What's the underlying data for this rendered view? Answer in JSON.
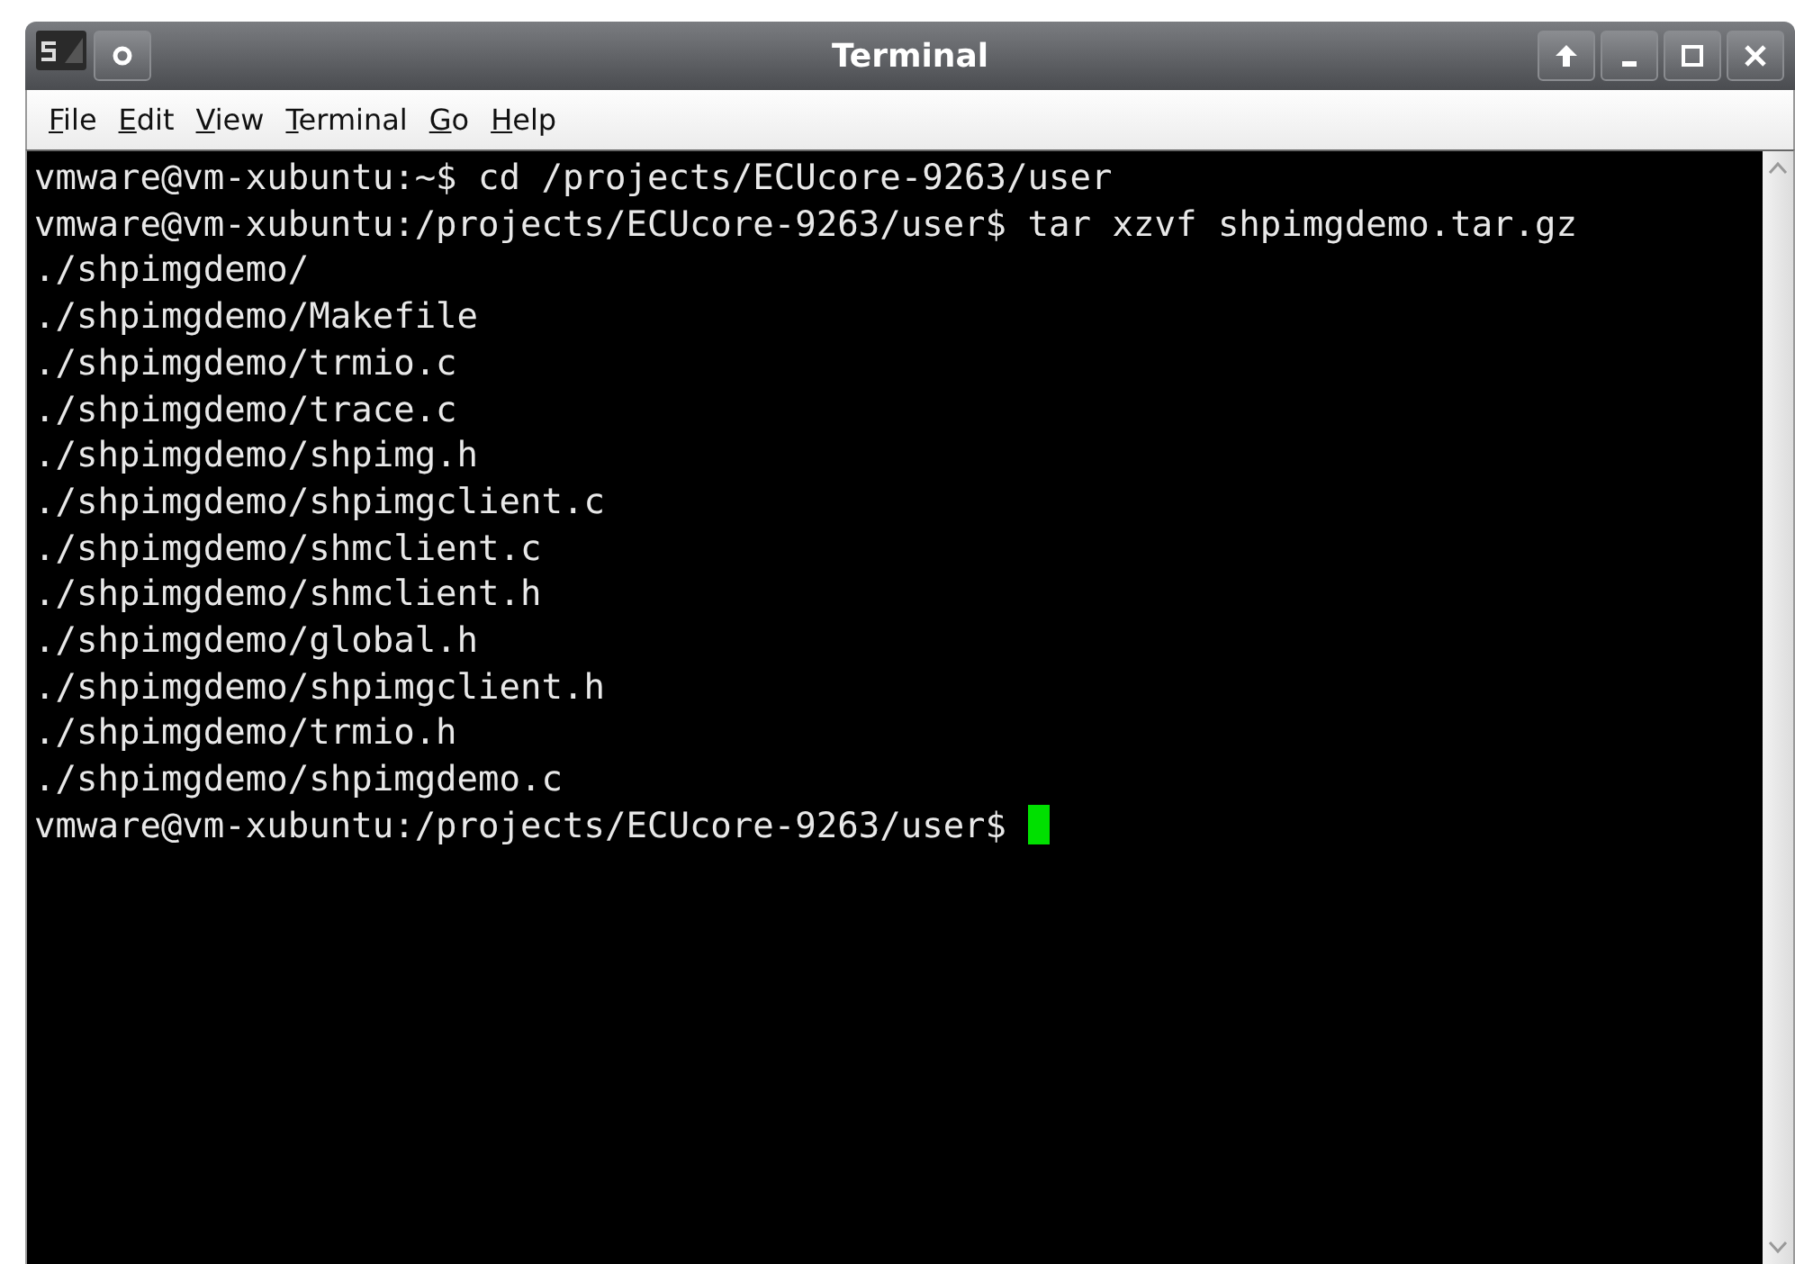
{
  "window": {
    "title": "Terminal"
  },
  "menu": [
    {
      "label": "File"
    },
    {
      "label": "Edit"
    },
    {
      "label": "View"
    },
    {
      "label": "Terminal"
    },
    {
      "label": "Go"
    },
    {
      "label": "Help"
    }
  ],
  "terminal": {
    "lines": [
      {
        "text": "vmware@vm-xubuntu:~$ cd /projects/ECUcore-9263/user",
        "cursor": false
      },
      {
        "text": "vmware@vm-xubuntu:/projects/ECUcore-9263/user$ tar xzvf shpimgdemo.tar.gz",
        "cursor": false
      },
      {
        "text": "./shpimgdemo/",
        "cursor": false
      },
      {
        "text": "./shpimgdemo/Makefile",
        "cursor": false
      },
      {
        "text": "./shpimgdemo/trmio.c",
        "cursor": false
      },
      {
        "text": "./shpimgdemo/trace.c",
        "cursor": false
      },
      {
        "text": "./shpimgdemo/shpimg.h",
        "cursor": false
      },
      {
        "text": "./shpimgdemo/shpimgclient.c",
        "cursor": false
      },
      {
        "text": "./shpimgdemo/shmclient.c",
        "cursor": false
      },
      {
        "text": "./shpimgdemo/shmclient.h",
        "cursor": false
      },
      {
        "text": "./shpimgdemo/global.h",
        "cursor": false
      },
      {
        "text": "./shpimgdemo/shpimgclient.h",
        "cursor": false
      },
      {
        "text": "./shpimgdemo/trmio.h",
        "cursor": false
      },
      {
        "text": "./shpimgdemo/shpimgdemo.c",
        "cursor": false
      },
      {
        "text": "vmware@vm-xubuntu:/projects/ECUcore-9263/user$",
        "cursor": true
      }
    ]
  }
}
